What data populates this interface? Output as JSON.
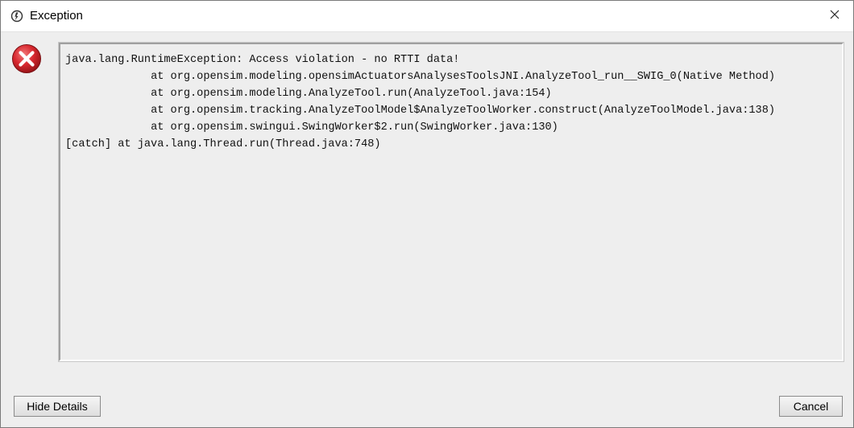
{
  "window": {
    "title": "Exception",
    "icons": {
      "app": "app-icon",
      "close": "close-icon",
      "status": "error-icon"
    }
  },
  "details": {
    "lines": [
      "java.lang.RuntimeException: Access violation - no RTTI data!",
      "\tat org.opensim.modeling.opensimActuatorsAnalysesToolsJNI.AnalyzeTool_run__SWIG_0(Native Method)",
      "\tat org.opensim.modeling.AnalyzeTool.run(AnalyzeTool.java:154)",
      "\tat org.opensim.tracking.AnalyzeToolModel$AnalyzeToolWorker.construct(AnalyzeToolModel.java:138)",
      "\tat org.opensim.swingui.SwingWorker$2.run(SwingWorker.java:130)",
      "[catch] at java.lang.Thread.run(Thread.java:748)"
    ]
  },
  "buttons": {
    "hide_details": "Hide Details",
    "cancel": "Cancel"
  },
  "colors": {
    "error_red": "#d8282f",
    "dialog_bg": "#eeeeee"
  }
}
